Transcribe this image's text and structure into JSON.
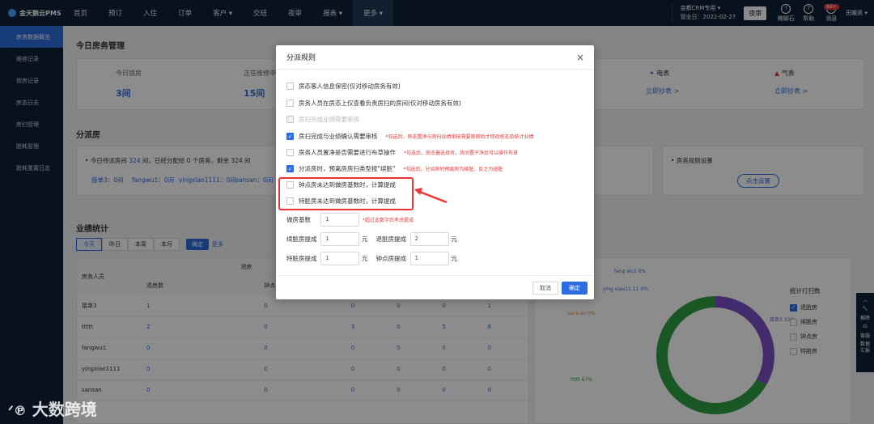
{
  "app": {
    "logo": "金天鹅云PMS"
  },
  "nav": {
    "items": [
      "首页",
      "预订",
      "入住",
      "订单",
      "客户 ▾",
      "交班",
      "夜审",
      "报表 ▾",
      "更多 ▾"
    ]
  },
  "topright": {
    "store": "金都CRM专用 ▾",
    "business_date": "营业日：2022-02-27",
    "audit": "夜审",
    "tools": [
      "椭聊石",
      "帮助",
      "消息"
    ],
    "badge": "99+",
    "user": "田媛凯 ▾"
  },
  "sidebar": {
    "items": [
      "房务数据概览",
      "维修记录",
      "锁房记录",
      "房态日志",
      "房扫管理",
      "脏耗管理",
      "脏耗重置日志"
    ]
  },
  "main": {
    "section1": "今日房务管理",
    "stats": [
      {
        "label": "今日锁房",
        "value": "3间"
      },
      {
        "label": "正在维修中",
        "value": "15间"
      }
    ],
    "meters": [
      {
        "label": "电表",
        "link": "立即抄表 >"
      },
      {
        "label": "气表",
        "link": "立即抄表 >"
      }
    ],
    "section2": "分派房",
    "assign_summary_prefix": "今日待派房间",
    "assign_total": "324",
    "assign_summary_suffix": "间，已经分配给 0 个房务，剩余 324 间",
    "assignees": [
      "接单3：0间",
      "fangwu1：0间",
      "yingxiao1111：0间",
      "sansan：0间"
    ],
    "rules": {
      "label": "房务规则设置",
      "button": "点击设置"
    },
    "section3": "业绩统计",
    "tabs": [
      "今天",
      "昨日",
      "本周",
      "本月"
    ],
    "confirm": "确定",
    "more": "更多",
    "table": {
      "header_col": "房务人员",
      "group": "退房",
      "subheaders": [
        "退房数",
        "钟点"
      ],
      "rows": [
        {
          "name": "接单3",
          "v": [
            "1",
            "0",
            "0",
            "0",
            "0",
            "1"
          ]
        },
        {
          "name": "ttttt",
          "v": [
            "2",
            "0",
            "3",
            "0",
            "5",
            "6"
          ]
        },
        {
          "name": "fangwu1",
          "v": [
            "0",
            "0",
            "0",
            "0",
            "0",
            "0"
          ]
        },
        {
          "name": "yingxiao1111",
          "v": [
            "0",
            "0",
            "0",
            "0",
            "0",
            "0"
          ]
        },
        {
          "name": "sansan",
          "v": [
            "0",
            "0",
            "0",
            "0",
            "0",
            "0"
          ]
        }
      ]
    },
    "chart": {
      "labels": [
        {
          "text": "fang wu1 0%"
        },
        {
          "text": "ying xiao11 11 0%"
        },
        {
          "text": "sans an 0%"
        },
        {
          "text": "接单3 33%"
        },
        {
          "text": "ttttt 67%"
        }
      ]
    },
    "stat_panel": {
      "title": "统计打扫数",
      "options": [
        {
          "label": "退脏房",
          "checked": true
        },
        {
          "label": "续脏房",
          "checked": false
        },
        {
          "label": "钟点房",
          "checked": false
        },
        {
          "label": "特脏房",
          "checked": false
        }
      ]
    }
  },
  "dialog": {
    "title": "分派规则",
    "close": "×",
    "options": [
      {
        "label": "房态客人信息保密(仅对移动房务有效)",
        "checked": false,
        "disabled": false,
        "note": ""
      },
      {
        "label": "房务人员在房态上仅查看负责房扫的房间(仅对移动房务有效)",
        "checked": false,
        "disabled": false,
        "note": ""
      },
      {
        "label": "房扫完成业绩需要审核",
        "checked": false,
        "disabled": true,
        "note": ""
      },
      {
        "label": "房扫完成与业绩确认需要审核",
        "checked": true,
        "disabled": false,
        "note": "*勾选后，房态置净与房扫业绩审核需要审审后才修改房态及统计业绩"
      },
      {
        "label": "房务人员置净是否需要进行布草操作",
        "checked": false,
        "disabled": false,
        "note": "*勾选后，房态叠选择房，房间置干净后可以操作布草"
      },
      {
        "label": "分派房时，预离房房扫类型按\"续脏\"",
        "checked": true,
        "disabled": false,
        "note": "*勾选后，分派房时预离房为续脏，反之为退脏"
      },
      {
        "label": "钟点房未达到做房基数时，计算提成",
        "checked": false,
        "disabled": false,
        "note": ""
      },
      {
        "label": "特脏房未达到做房基数时，计算提成",
        "checked": false,
        "disabled": false,
        "note": ""
      }
    ],
    "base_label": "做房基数",
    "base_value": "1",
    "base_note": "*超过此数字后考虑提成",
    "fields": [
      {
        "label": "续脏房提成",
        "value": "1",
        "unit": "元"
      },
      {
        "label": "退脏房提成",
        "value": "2",
        "unit": "元"
      },
      {
        "label": "特脏房提成",
        "value": "1",
        "unit": "元"
      },
      {
        "label": "钟点房提成",
        "value": "1",
        "unit": "元"
      }
    ],
    "cancel": "取消",
    "ok": "确定"
  },
  "fab": {
    "items": [
      "推降",
      "客服",
      "数据汇报"
    ]
  },
  "watermark": "大数跨境",
  "colors": {
    "primary": "#2d6cdf",
    "nav": "#0e2238",
    "donut_green": "#2f9e44",
    "donut_purple": "#7b4fc9",
    "highlight": "#e33333"
  }
}
